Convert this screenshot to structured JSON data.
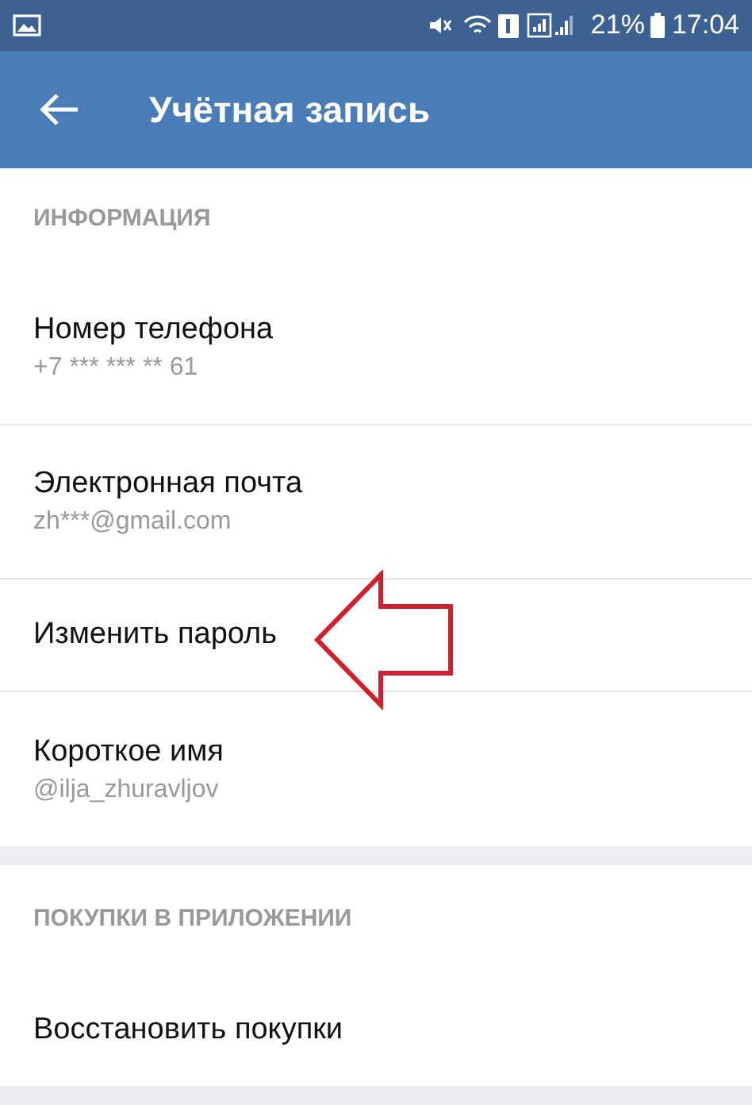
{
  "status_bar": {
    "battery": "21%",
    "time": "17:04"
  },
  "toolbar": {
    "title": "Учётная запись"
  },
  "sections": [
    {
      "header": "ИНФОРМАЦИЯ",
      "items": [
        {
          "title": "Номер телефона",
          "subtitle": "+7 *** *** ** 61"
        },
        {
          "title": "Электронная почта",
          "subtitle": "zh***@gmail.com"
        },
        {
          "title": "Изменить пароль",
          "highlighted": true
        },
        {
          "title": "Короткое имя",
          "subtitle": "@ilja_zhuravljov"
        }
      ]
    },
    {
      "header": "ПОКУПКИ В ПРИЛОЖЕНИИ",
      "items": [
        {
          "title": "Восстановить покупки"
        }
      ]
    }
  ]
}
